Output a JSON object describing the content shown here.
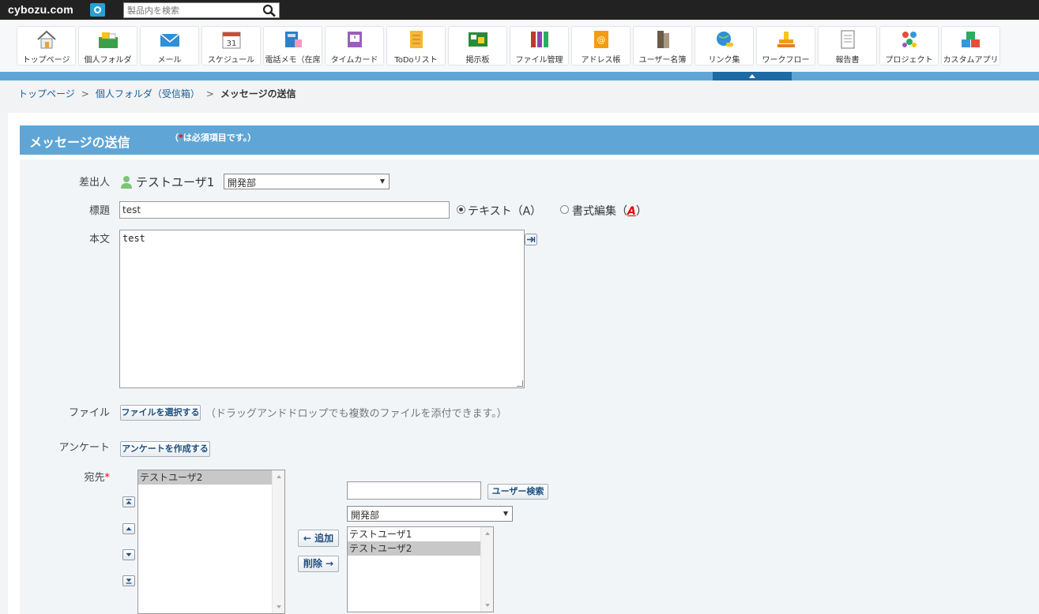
{
  "header": {
    "logo": "cybozu.com",
    "search_placeholder": "製品内を検索"
  },
  "apps": [
    {
      "label": "トップページ",
      "icon": "home-icon"
    },
    {
      "label": "個人フォルダ",
      "icon": "personal-folder-icon"
    },
    {
      "label": "メール",
      "icon": "mail-icon"
    },
    {
      "label": "スケジュール",
      "icon": "calendar-icon"
    },
    {
      "label": "電話メモ（在席",
      "icon": "phone-memo-icon"
    },
    {
      "label": "タイムカード",
      "icon": "timecard-icon"
    },
    {
      "label": "ToDoリスト",
      "icon": "todo-icon"
    },
    {
      "label": "掲示板",
      "icon": "bulletin-board-icon"
    },
    {
      "label": "ファイル管理",
      "icon": "file-cabinet-icon"
    },
    {
      "label": "アドレス帳",
      "icon": "address-book-icon"
    },
    {
      "label": "ユーザー名簿",
      "icon": "user-directory-icon"
    },
    {
      "label": "リンク集",
      "icon": "link-globe-icon"
    },
    {
      "label": "ワークフロー",
      "icon": "workflow-stamp-icon"
    },
    {
      "label": "報告書",
      "icon": "report-icon"
    },
    {
      "label": "プロジェクト",
      "icon": "project-icon"
    },
    {
      "label": "カスタムアプリ",
      "icon": "custom-app-icon"
    }
  ],
  "breadcrumb": {
    "items": [
      "トップページ",
      "個人フォルダ（受信箱）"
    ],
    "current": "メッセージの送信"
  },
  "page": {
    "title": "メッセージの送信",
    "required_note_open": "（",
    "required_star": "*",
    "required_note": "は必須項目です。）"
  },
  "form": {
    "sender_label": "差出人",
    "sender_name": "テストユーザ1",
    "sender_dept": "開発部",
    "subject_label": "標題",
    "subject_value": "test",
    "format_text": "テキスト（A）",
    "format_rich": "書式編集（",
    "format_rich_icon": "A",
    "format_rich_close": "）",
    "body_label": "本文",
    "body_value": "test",
    "file_label": "ファイル",
    "file_button": "ファイルを選択する",
    "file_hint": "（ドラッグアンドドロップでも複数のファイルを添付できます。）",
    "survey_label": "アンケート",
    "survey_button": "アンケートを作成する",
    "recipients_label": "宛先",
    "recipients_star": "*",
    "recipients": [
      "テストユーザ2"
    ],
    "add_button": "← 追加",
    "remove_button": "削除 →",
    "user_search_button": "ユーザー検索",
    "user_search_value": "",
    "candidate_dept": "開発部",
    "candidates": [
      "テストユーザ1",
      "テストユーザ2"
    ]
  },
  "colors": {
    "title_bar": "#5fa6d6",
    "selected_tab": "#1d6aa5",
    "required_star": "#ee0000"
  }
}
